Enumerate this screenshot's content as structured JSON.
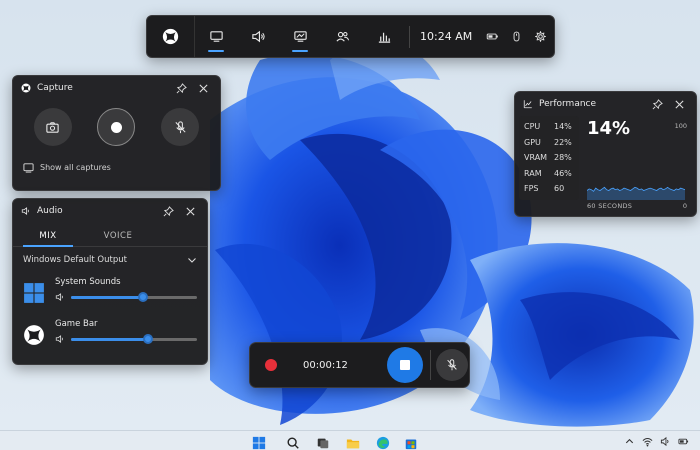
{
  "topbar": {
    "time": "10:24 AM",
    "widgets": [
      "xbox-logo",
      "capture-widget",
      "audio-widget",
      "performance-widget",
      "social-widget",
      "resources-widget"
    ]
  },
  "capture": {
    "title": "Capture",
    "show_all_label": "Show all captures"
  },
  "audio": {
    "title": "Audio",
    "tabs": [
      {
        "label": "MIX",
        "active": true
      },
      {
        "label": "VOICE",
        "active": false
      }
    ],
    "output_device": "Windows Default Output",
    "apps": [
      {
        "name": "System Sounds",
        "volume": 0.57
      },
      {
        "name": "Game Bar",
        "volume": 0.61
      }
    ]
  },
  "performance": {
    "title": "Performance",
    "stats": [
      {
        "label": "CPU",
        "value": "14%"
      },
      {
        "label": "GPU",
        "value": "22%"
      },
      {
        "label": "VRAM",
        "value": "28%"
      },
      {
        "label": "RAM",
        "value": "46%"
      },
      {
        "label": "FPS",
        "value": "60"
      }
    ],
    "big_value": "14%",
    "y_max": "100",
    "x_label": "60 SECONDS",
    "x_end": "0",
    "history": [
      12,
      14,
      13,
      11,
      15,
      13,
      12,
      14,
      16,
      13,
      12,
      14,
      15,
      13,
      14,
      12,
      13,
      15,
      14,
      13,
      12,
      14,
      16,
      15,
      13,
      14,
      12,
      13,
      14,
      15,
      14,
      13,
      12,
      14,
      15,
      13,
      14,
      16,
      14,
      13,
      12,
      14,
      13,
      15,
      14,
      13
    ]
  },
  "recording": {
    "elapsed": "00:00:12"
  },
  "colors": {
    "accent": "#3b8eea",
    "record": "#e8303a",
    "panel_bg": "#1c1c1e"
  }
}
